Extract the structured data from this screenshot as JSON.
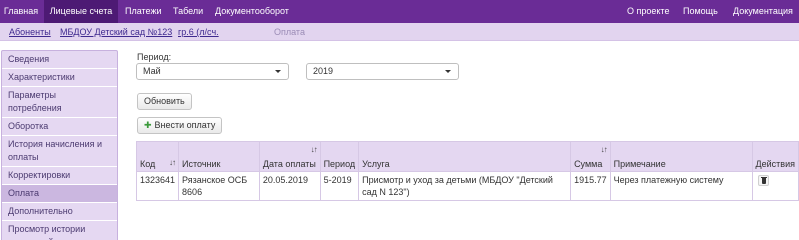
{
  "topnav": {
    "items": [
      "Главная",
      "Лицевые счета",
      "Платежи",
      "Табели",
      "Документооборот"
    ],
    "right": [
      "О проекте",
      "Помощь",
      "Документация"
    ]
  },
  "breadcrumb": {
    "items": [
      "Абоненты",
      "МБДОУ Детский сад  №123",
      "гр.6 (л/сч.",
      "Оплата"
    ]
  },
  "sidebar": {
    "items": [
      "Сведения",
      "Характеристики",
      "Параметры потребления",
      "Оборотка",
      "История начисления и оплаты",
      "Корректировки",
      "Оплата",
      "Дополнительно",
      "Просмотр истории изменений"
    ]
  },
  "filters": {
    "period_label": "Период:",
    "month": "Май",
    "year": "2019"
  },
  "buttons": {
    "refresh": "Обновить",
    "add_payment": "Внести оплату"
  },
  "table": {
    "columns": [
      "Код",
      "Источник",
      "Дата оплаты",
      "Период",
      "Услуга",
      "Сумма",
      "Примечание",
      "Действия"
    ],
    "rows": [
      {
        "code": "1323641",
        "source": "Рязанское ОСБ 8606",
        "date": "20.05.2019",
        "period": "5-2019",
        "service": "Присмотр и уход за детьми (МБДОУ \"Детский сад N 123\")",
        "amount": "1915.77",
        "note": "Через платежную систему"
      }
    ]
  },
  "colors": {
    "nav_bg": "#6a2c96",
    "nav_active": "#4d1a74",
    "breadcrumb_bg": "#e2d4ef",
    "sidebar_bg": "#e5d8f2",
    "sidebar_active": "#cbb7e0",
    "table_header_bg": "#e4d7f1"
  },
  "icons": {
    "sort": "sort-icon",
    "add": "plus-icon",
    "delete": "trash-icon",
    "dropdown": "chevron-down-icon"
  }
}
